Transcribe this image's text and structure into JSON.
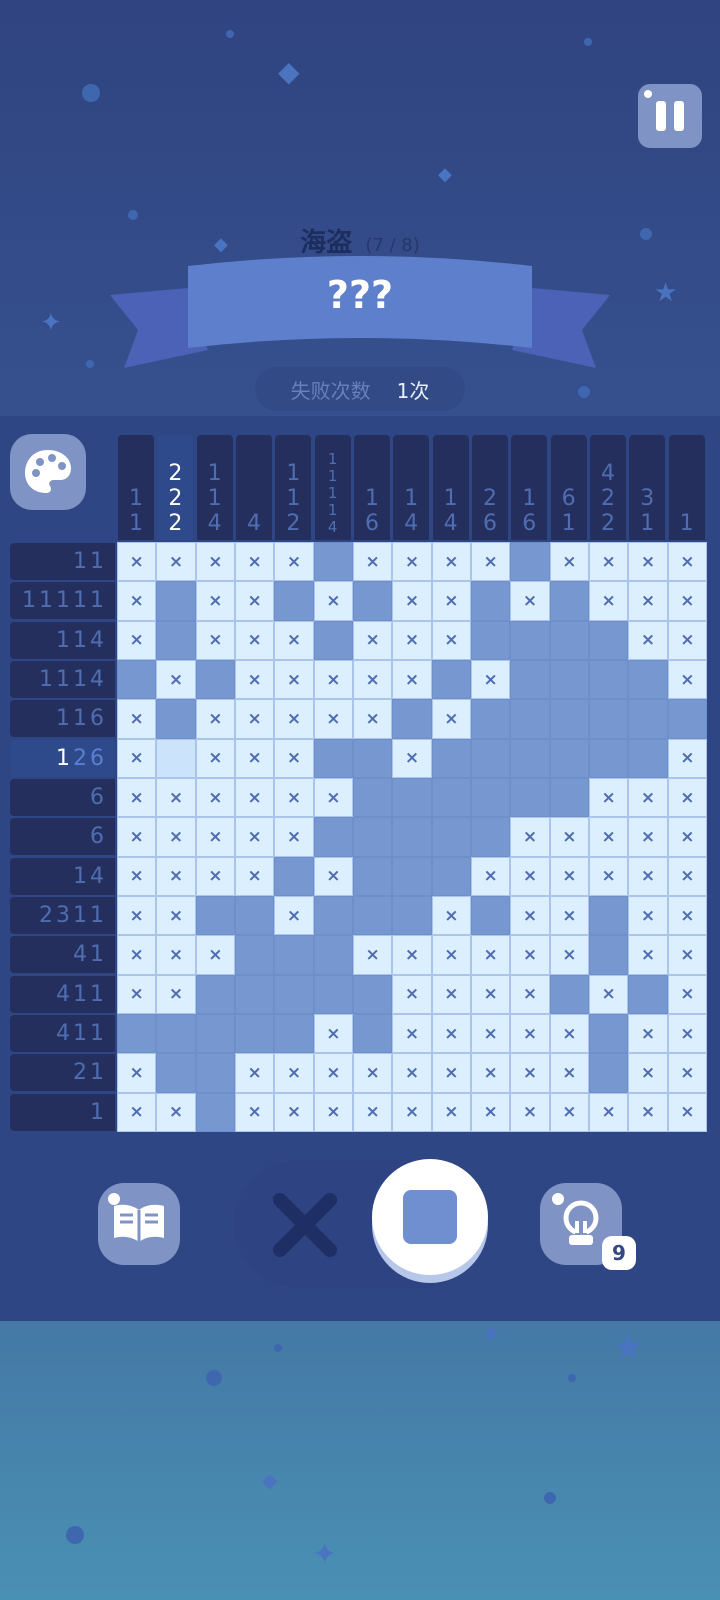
{
  "level": {
    "name": "海盗",
    "progress": "(7 / 8)",
    "title": "???"
  },
  "mistakes": {
    "label": "失败次数",
    "value": "1次"
  },
  "col_clues": [
    [
      "1",
      "1"
    ],
    [
      "2",
      "2",
      "2"
    ],
    [
      "1",
      "1",
      "4"
    ],
    [
      "4"
    ],
    [
      "1",
      "1",
      "2"
    ],
    [
      "1",
      "1",
      "1",
      "1",
      "4"
    ],
    [
      "1",
      "6"
    ],
    [
      "1",
      "4"
    ],
    [
      "1",
      "4"
    ],
    [
      "2",
      "6"
    ],
    [
      "1",
      "6"
    ],
    [
      "6",
      "1"
    ],
    [
      "4",
      "2",
      "2"
    ],
    [
      "3",
      "1"
    ],
    [
      "1"
    ]
  ],
  "active_col": 1,
  "row_clues": [
    "11",
    "11111",
    "114",
    "1114",
    "116",
    "126",
    "6",
    "6",
    "14",
    "2311",
    "41",
    "411",
    "411",
    "21",
    "1"
  ],
  "active_row": 5,
  "active_row_highlight": "1",
  "active_row_rest": "26",
  "grid": [
    "xxxxxfxxxxfxxxx",
    "xfxxfxfxxfxfxxx",
    "xfxxxfxxxffffxx",
    "fxfxxxxxfxffffx",
    "xfxxxxxfxfffffff",
    "xhxxxffxffffffx",
    "xxxxxxffffffxxx",
    "xxxxxfffffxxxxx",
    "xxxxfxfffxxxxxx",
    "xxffxfffxfxxfxx",
    "xxxfffxxxxxxfxx",
    "xxfffffxxxxfxfx",
    "fffffxfxxxxxfxx",
    "xffxxxxxxxxxfxx",
    "xxfxxxxxxxxxxxx"
  ],
  "hint_count": "9",
  "icons": {
    "pause": "pause-icon",
    "palette": "palette-icon",
    "dictionary": "book-icon",
    "cross_mode": "cross-icon",
    "fill_mode": "square-fill-icon",
    "hint": "lightbulb-icon"
  },
  "colors": {
    "filled": "#7797d1",
    "empty": "#dcefff",
    "clue_bg": "#242f5e",
    "accent": "#6f8fd0"
  }
}
